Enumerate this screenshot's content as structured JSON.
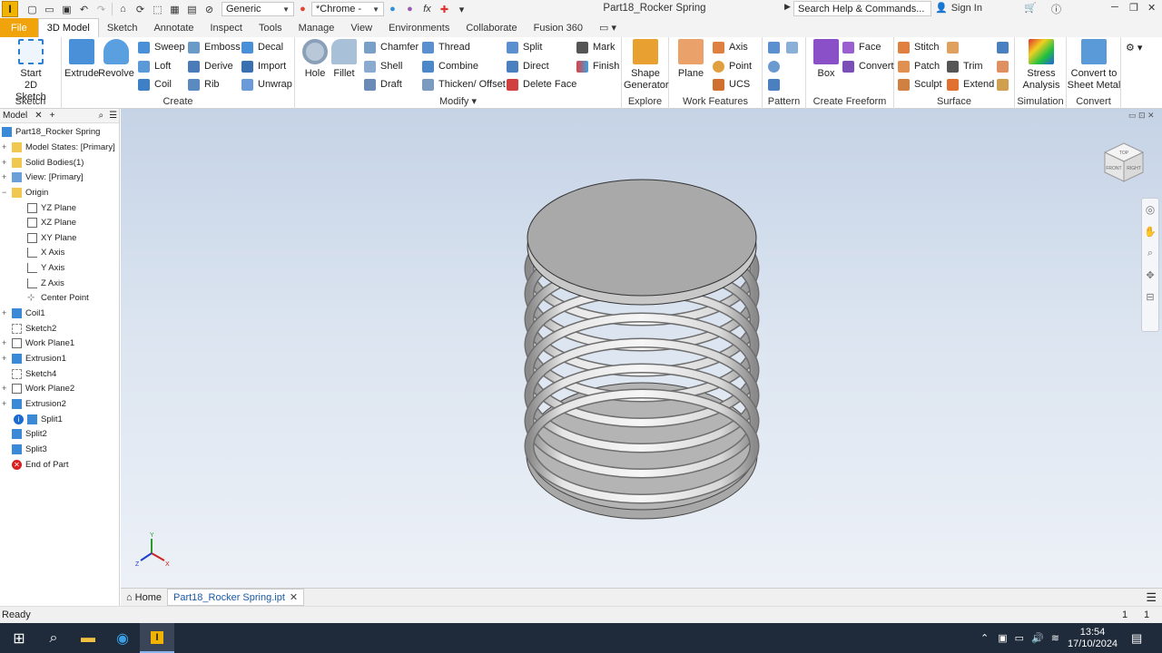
{
  "window": {
    "title": "Part18_Rocker Spring"
  },
  "qat": {
    "appearance": "Generic",
    "material": "*Chrome -",
    "search_placeholder": "Search Help & Commands...",
    "sign_in": "Sign In"
  },
  "tabs": [
    {
      "label": "File"
    },
    {
      "label": "3D Model"
    },
    {
      "label": "Sketch"
    },
    {
      "label": "Annotate"
    },
    {
      "label": "Inspect"
    },
    {
      "label": "Tools"
    },
    {
      "label": "Manage"
    },
    {
      "label": "View"
    },
    {
      "label": "Environments"
    },
    {
      "label": "Collaborate"
    },
    {
      "label": "Fusion 360"
    }
  ],
  "ribbon": {
    "sketch": {
      "label": "Sketch",
      "start": "Start",
      "start2": "2D Sketch"
    },
    "create": {
      "label": "Create",
      "extrude": "Extrude",
      "revolve": "Revolve",
      "sweep": "Sweep",
      "loft": "Loft",
      "coil": "Coil",
      "emboss": "Emboss",
      "derive": "Derive",
      "rib": "Rib",
      "decal": "Decal",
      "import": "Import",
      "unwrap": "Unwrap"
    },
    "modify": {
      "label": "Modify",
      "hole": "Hole",
      "fillet": "Fillet",
      "chamfer": "Chamfer",
      "shell": "Shell",
      "draft": "Draft",
      "thread": "Thread",
      "combine": "Combine",
      "thicken": "Thicken/ Offset",
      "split": "Split",
      "direct": "Direct",
      "delete_face": "Delete Face",
      "mark": "Mark",
      "finish": "Finish"
    },
    "explore": {
      "label": "Explore",
      "shape": "Shape",
      "generator": "Generator"
    },
    "work": {
      "label": "Work Features",
      "plane": "Plane",
      "axis": "Axis",
      "point": "Point",
      "ucs": "UCS"
    },
    "pattern": {
      "label": "Pattern"
    },
    "freeform": {
      "label": "Create Freeform",
      "box": "Box",
      "face": "Face",
      "convert": "Convert"
    },
    "surface": {
      "label": "Surface",
      "stitch": "Stitch",
      "patch": "Patch",
      "sculpt": "Sculpt",
      "trim": "Trim",
      "extend": "Extend"
    },
    "simulation": {
      "label": "Simulation",
      "stress": "Stress",
      "analysis": "Analysis"
    },
    "convert": {
      "label": "Convert",
      "to": "Convert to",
      "sheet": "Sheet Metal"
    }
  },
  "browser": {
    "tab": "Model",
    "nodes": [
      {
        "label": "Part18_Rocker Spring"
      },
      {
        "label": "Model States: [Primary]"
      },
      {
        "label": "Solid Bodies(1)"
      },
      {
        "label": "View: [Primary]"
      },
      {
        "label": "Origin"
      },
      {
        "label": "YZ Plane"
      },
      {
        "label": "XZ Plane"
      },
      {
        "label": "XY Plane"
      },
      {
        "label": "X Axis"
      },
      {
        "label": "Y Axis"
      },
      {
        "label": "Z Axis"
      },
      {
        "label": "Center Point"
      },
      {
        "label": "Coil1"
      },
      {
        "label": "Sketch2"
      },
      {
        "label": "Work Plane1"
      },
      {
        "label": "Extrusion1"
      },
      {
        "label": "Sketch4"
      },
      {
        "label": "Work Plane2"
      },
      {
        "label": "Extrusion2"
      },
      {
        "label": "Split1"
      },
      {
        "label": "Split2"
      },
      {
        "label": "Split3"
      },
      {
        "label": "End of Part"
      }
    ]
  },
  "viewcube": {
    "top": "TOP",
    "front": "FRONT",
    "right": "RIGHT"
  },
  "triad": {
    "x": "X",
    "y": "Y",
    "z": "Z"
  },
  "doc_tabs": {
    "home": "Home",
    "active": "Part18_Rocker Spring.ipt"
  },
  "status": {
    "text": "Ready",
    "count1": "1",
    "count2": "1"
  },
  "taskbar": {
    "time": "13:54",
    "date": "17/10/2024"
  }
}
